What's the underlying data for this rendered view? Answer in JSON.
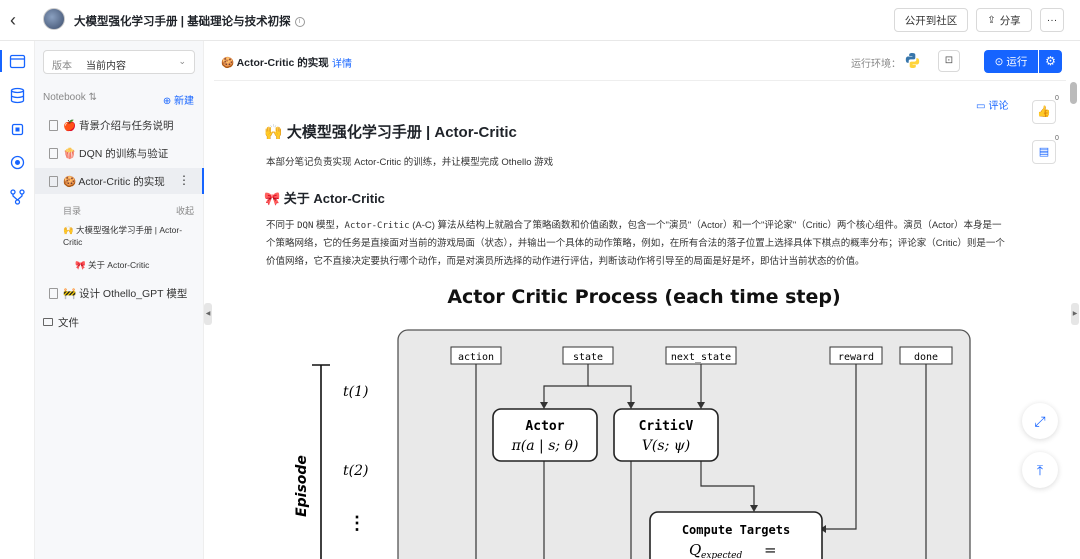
{
  "header": {
    "title": "大模型强化学习手册 | 基础理论与技术初探",
    "publish_label": "公开到社区",
    "share_label": "分享",
    "more_label": "···",
    "back_label": "‹"
  },
  "sidebar": {
    "version_label": "版本",
    "version_value": "当前内容",
    "notebook_label": "Notebook ⇅",
    "new_label": "⊕ 新建",
    "items": [
      {
        "label": "🍎 背景介绍与任务说明"
      },
      {
        "label": "🍿 DQN 的训练与验证"
      },
      {
        "label": "🍪 Actor-Critic 的实现"
      },
      {
        "label": "🚧 设计 Othello_GPT 模型"
      }
    ],
    "files_label": "文件",
    "toc_label": "目录",
    "toc_collapse": "收起",
    "toc": [
      "🙌 大模型强化学习手册 | Actor-Critic",
      "🎀 关于 Actor-Critic"
    ]
  },
  "toolbar": {
    "crumb": "🍪 Actor-Critic 的实现",
    "detail": "详情",
    "env_label": "运行环境：",
    "run_label": "⊙ 运行"
  },
  "content": {
    "comment": "评论",
    "title": "🙌 大模型强化学习手册 | Actor-Critic",
    "intro": "本部分笔记负责实现 Actor-Critic 的训练，并让模型完成 Othello 游戏",
    "section": "🎀 关于 Actor-Critic",
    "para_a": "不同于 ",
    "para_code1": "DQN",
    "para_b": " 模型，",
    "para_code2": "Actor-Critic",
    "para_c": " (A-C) 算法从结构上就融合了策略函数和价值函数，包含一个\"演员\"（Actor）和一个\"评论家\"（Critic）两个核心组件。演员（Actor）本身是一个策略网络，它的任务是直接面对当前的游戏局面（状态），并输出一个具体的动作策略，例如，在所有合法的落子位置上选择具体下棋点的概率分布；评论家（Critic）则是一个价值网络，它不直接决定要执行哪个动作，而是对演员所选择的动作进行评估，判断该动作将引导至的局面是好是坏，即估计当前状态的价值。"
  },
  "figure": {
    "title": "Actor Critic Process (each time step)",
    "inputs": [
      "action",
      "state",
      "next_state",
      "reward",
      "done"
    ],
    "actor": "Actor",
    "actor_f": "π(a | s; θ)",
    "critic": "CriticV",
    "critic_f": "V(s; ψ)",
    "targets": "Compute Targets",
    "targets_f": "Q",
    "targets_sub": "expected",
    "targets_eq": "=",
    "episode": "Episode",
    "t1": "t(1)",
    "t2": "t(2)",
    "dots": "⋮"
  },
  "right": {
    "like_count": "0",
    "comment_count": "0"
  }
}
